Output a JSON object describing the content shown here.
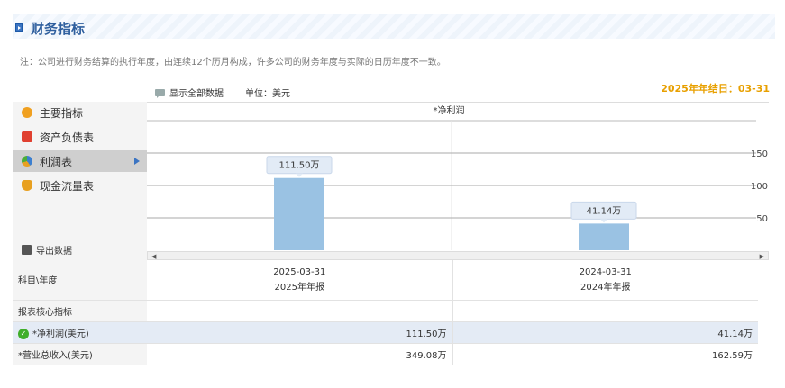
{
  "header": {
    "title": "财务指标"
  },
  "note": "注：公司进行财务结算的执行年度，由连续12个历月构成，许多公司的财务年度与实际的日历年度不一致。",
  "toolbar": {
    "show_all": "显示全部数据",
    "unit": "单位：美元",
    "year_end": "2025年年结日：03-31"
  },
  "sidebar": {
    "items": [
      {
        "label": "主要指标",
        "icon": "sun-icon",
        "color": "#f0a020"
      },
      {
        "label": "资产负债表",
        "icon": "document-icon",
        "color": "#e04030"
      },
      {
        "label": "利润表",
        "icon": "pie-chart-icon",
        "color": "#3b7fd0"
      },
      {
        "label": "现金流量表",
        "icon": "coins-icon",
        "color": "#e8a020"
      }
    ],
    "active_index": 2,
    "export_label": "导出数据"
  },
  "chart_data": {
    "type": "bar",
    "title": "*净利润",
    "categories": [
      "2025-03-31",
      "2024-03-31"
    ],
    "values": [
      111.5,
      41.14
    ],
    "data_labels": [
      "111.50万",
      "41.14万"
    ],
    "yticks": [
      50,
      100,
      150
    ],
    "ylim": [
      0,
      150
    ],
    "bar_color": "#9ac2e3",
    "grid": true
  },
  "table": {
    "corner": "科目\\年度",
    "columns": [
      {
        "date": "2025-03-31",
        "report": "2025年年报"
      },
      {
        "date": "2024-03-31",
        "report": "2024年年报"
      }
    ],
    "section": "报表核心指标",
    "rows": [
      {
        "label": "*净利润(美元)",
        "v1": "111.50万",
        "v2": "41.14万"
      },
      {
        "label": "*营业总收入(美元)",
        "v1": "349.08万",
        "v2": "162.59万"
      }
    ]
  }
}
